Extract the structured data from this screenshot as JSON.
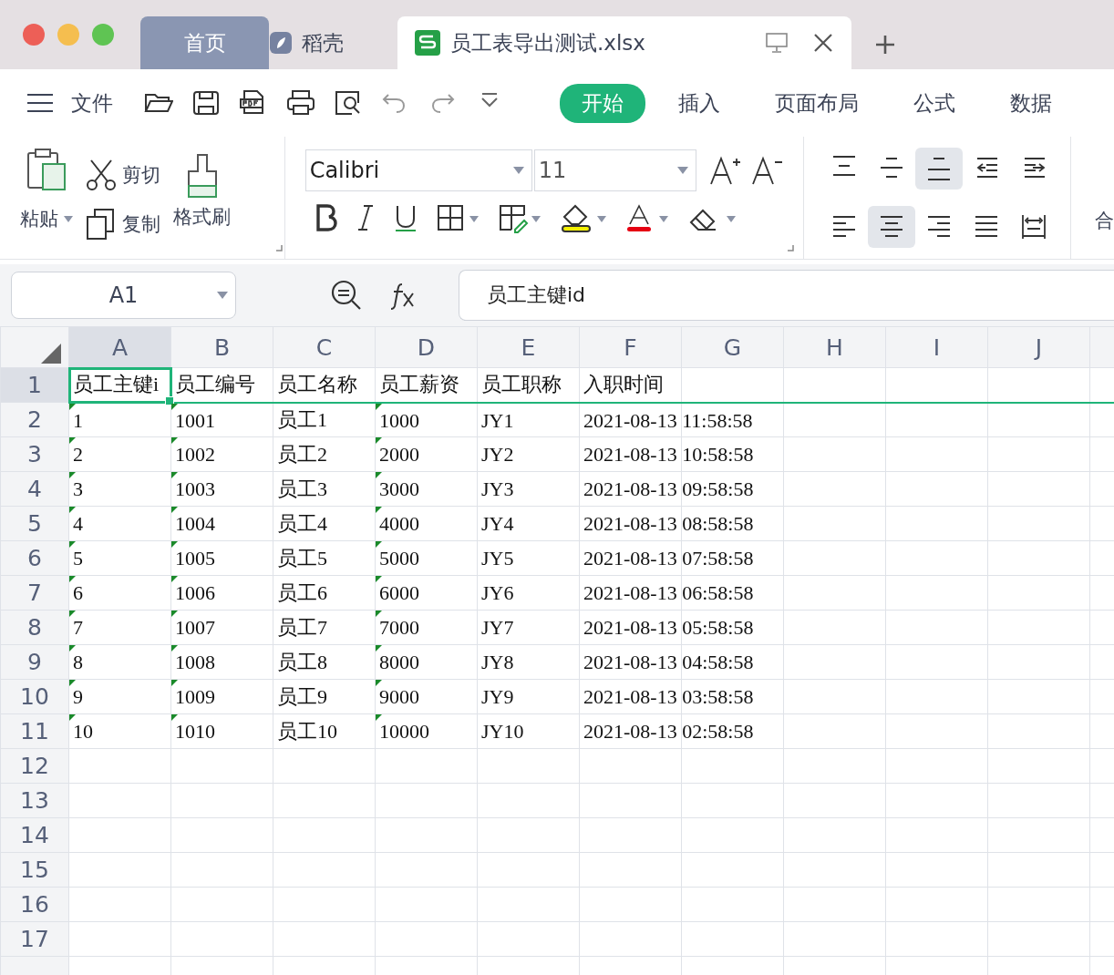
{
  "window": {
    "tabs": [
      {
        "label": "首页",
        "kind": "home",
        "selected": false
      },
      {
        "label": "稻壳",
        "kind": "docer",
        "selected": false
      },
      {
        "label": "员工表导出测试.xlsx",
        "kind": "sheet",
        "selected": true
      }
    ]
  },
  "menu": {
    "label": "文件"
  },
  "ribbon_tabs": [
    {
      "label": "开始",
      "selected": true
    },
    {
      "label": "插入",
      "selected": false
    },
    {
      "label": "页面布局",
      "selected": false
    },
    {
      "label": "公式",
      "selected": false
    },
    {
      "label": "数据",
      "selected": false
    }
  ],
  "clipboard": {
    "paste": "粘贴",
    "cut": "剪切",
    "copy": "复制",
    "format_painter": "格式刷"
  },
  "font": {
    "name": "Calibri",
    "size": "11"
  },
  "align_buttons": [
    {
      "kind": "top",
      "pressed": false
    },
    {
      "kind": "middle",
      "pressed": false
    },
    {
      "kind": "bottom",
      "pressed": true
    },
    {
      "kind": "outdent",
      "pressed": false
    },
    {
      "kind": "indent",
      "pressed": false
    },
    {
      "kind": "left",
      "pressed": false
    },
    {
      "kind": "center",
      "pressed": true
    },
    {
      "kind": "right",
      "pressed": false
    },
    {
      "kind": "justify",
      "pressed": false
    },
    {
      "kind": "distribute",
      "pressed": false
    }
  ],
  "merge": {
    "label": "合"
  },
  "name_box": {
    "value": "A1"
  },
  "formula_bar": {
    "value": "员工主键id"
  },
  "columns": [
    {
      "label": "A",
      "selected": true
    },
    {
      "label": "B",
      "selected": false
    },
    {
      "label": "C",
      "selected": false
    },
    {
      "label": "D",
      "selected": false
    },
    {
      "label": "E",
      "selected": false
    },
    {
      "label": "F",
      "selected": false
    },
    {
      "label": "G",
      "selected": false
    },
    {
      "label": "H",
      "selected": false
    },
    {
      "label": "I",
      "selected": false
    },
    {
      "label": "J",
      "selected": false
    }
  ],
  "rows": [
    {
      "number": "1",
      "selected": true,
      "cells": [
        {
          "text": "员工主键i",
          "flag": false,
          "active": true
        },
        {
          "text": "员工编号",
          "flag": false
        },
        {
          "text": "员工名称",
          "flag": false
        },
        {
          "text": "员工薪资",
          "flag": false
        },
        {
          "text": "员工职称",
          "flag": false
        },
        {
          "text": "入职时间",
          "flag": false
        }
      ]
    },
    {
      "number": "2",
      "selected": false,
      "cells": [
        {
          "text": "1",
          "flag": true
        },
        {
          "text": "1001",
          "flag": true
        },
        {
          "text": "员工1",
          "flag": false
        },
        {
          "text": "1000",
          "flag": true
        },
        {
          "text": "JY1",
          "flag": false
        },
        {
          "text": "2021-08-13 11:58:58",
          "flag": false
        }
      ]
    },
    {
      "number": "3",
      "selected": false,
      "cells": [
        {
          "text": "2",
          "flag": true
        },
        {
          "text": "1002",
          "flag": true
        },
        {
          "text": "员工2",
          "flag": false
        },
        {
          "text": "2000",
          "flag": true
        },
        {
          "text": "JY2",
          "flag": false
        },
        {
          "text": "2021-08-13 10:58:58",
          "flag": false
        }
      ]
    },
    {
      "number": "4",
      "selected": false,
      "cells": [
        {
          "text": "3",
          "flag": true
        },
        {
          "text": "1003",
          "flag": true
        },
        {
          "text": "员工3",
          "flag": false
        },
        {
          "text": "3000",
          "flag": true
        },
        {
          "text": "JY3",
          "flag": false
        },
        {
          "text": "2021-08-13 09:58:58",
          "flag": false
        }
      ]
    },
    {
      "number": "5",
      "selected": false,
      "cells": [
        {
          "text": "4",
          "flag": true
        },
        {
          "text": "1004",
          "flag": true
        },
        {
          "text": "员工4",
          "flag": false
        },
        {
          "text": "4000",
          "flag": true
        },
        {
          "text": "JY4",
          "flag": false
        },
        {
          "text": "2021-08-13 08:58:58",
          "flag": false
        }
      ]
    },
    {
      "number": "6",
      "selected": false,
      "cells": [
        {
          "text": "5",
          "flag": true
        },
        {
          "text": "1005",
          "flag": true
        },
        {
          "text": "员工5",
          "flag": false
        },
        {
          "text": "5000",
          "flag": true
        },
        {
          "text": "JY5",
          "flag": false
        },
        {
          "text": "2021-08-13 07:58:58",
          "flag": false
        }
      ]
    },
    {
      "number": "7",
      "selected": false,
      "cells": [
        {
          "text": "6",
          "flag": true
        },
        {
          "text": "1006",
          "flag": true
        },
        {
          "text": "员工6",
          "flag": false
        },
        {
          "text": "6000",
          "flag": true
        },
        {
          "text": "JY6",
          "flag": false
        },
        {
          "text": "2021-08-13 06:58:58",
          "flag": false
        }
      ]
    },
    {
      "number": "8",
      "selected": false,
      "cells": [
        {
          "text": "7",
          "flag": true
        },
        {
          "text": "1007",
          "flag": true
        },
        {
          "text": "员工7",
          "flag": false
        },
        {
          "text": "7000",
          "flag": true
        },
        {
          "text": "JY7",
          "flag": false
        },
        {
          "text": "2021-08-13 05:58:58",
          "flag": false
        }
      ]
    },
    {
      "number": "9",
      "selected": false,
      "cells": [
        {
          "text": "8",
          "flag": true
        },
        {
          "text": "1008",
          "flag": true
        },
        {
          "text": "员工8",
          "flag": false
        },
        {
          "text": "8000",
          "flag": true
        },
        {
          "text": "JY8",
          "flag": false
        },
        {
          "text": "2021-08-13 04:58:58",
          "flag": false
        }
      ]
    },
    {
      "number": "10",
      "selected": false,
      "cells": [
        {
          "text": "9",
          "flag": true
        },
        {
          "text": "1009",
          "flag": true
        },
        {
          "text": "员工9",
          "flag": false
        },
        {
          "text": "9000",
          "flag": true
        },
        {
          "text": "JY9",
          "flag": false
        },
        {
          "text": "2021-08-13 03:58:58",
          "flag": false
        }
      ]
    },
    {
      "number": "11",
      "selected": false,
      "cells": [
        {
          "text": "10",
          "flag": true
        },
        {
          "text": "1010",
          "flag": true
        },
        {
          "text": "员工10",
          "flag": false
        },
        {
          "text": "10000",
          "flag": true
        },
        {
          "text": "JY10",
          "flag": false
        },
        {
          "text": "2021-08-13 02:58:58",
          "flag": false
        }
      ]
    },
    {
      "number": "12",
      "selected": false,
      "cells": []
    },
    {
      "number": "13",
      "selected": false,
      "cells": []
    },
    {
      "number": "14",
      "selected": false,
      "cells": []
    },
    {
      "number": "15",
      "selected": false,
      "cells": []
    },
    {
      "number": "16",
      "selected": false,
      "cells": []
    },
    {
      "number": "17",
      "selected": false,
      "cells": []
    }
  ]
}
